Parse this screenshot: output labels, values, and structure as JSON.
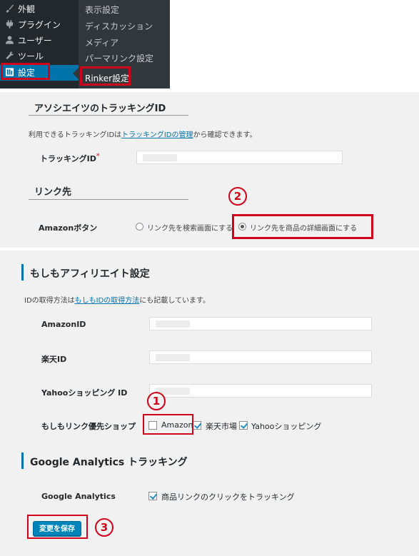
{
  "admin_menu": {
    "items": [
      {
        "label": "外観",
        "icon": "paintbrush-icon"
      },
      {
        "label": "プラグイン",
        "icon": "plugin-icon"
      },
      {
        "label": "ユーザー",
        "icon": "user-icon"
      },
      {
        "label": "ツール",
        "icon": "wrench-icon"
      },
      {
        "label": "設定",
        "icon": "settings-icon",
        "active": true
      }
    ],
    "submenu": [
      {
        "label": "表示設定"
      },
      {
        "label": "ディスカッション"
      },
      {
        "label": "メディア"
      },
      {
        "label": "パーマリンク設定"
      },
      {
        "label": "Rinker設定",
        "current": true
      }
    ]
  },
  "associate": {
    "title": "アソシエイツのトラッキングID",
    "desc_before": "利用できるトラッキングIDは",
    "desc_link": "トラッキングIDの管理",
    "desc_after": "から確認できます。",
    "tracking_label": "トラッキングID",
    "required_mark": "*",
    "tracking_value": ""
  },
  "link_dest": {
    "title": "リンク先",
    "amazon_button_label": "Amazonボタン",
    "option_search": "リンク先を検索画面にする",
    "option_detail": "リンク先を商品の詳細画面にする",
    "selected": "detail"
  },
  "moshimo": {
    "title": "もしもアフィリエイト設定",
    "desc_before": "IDの取得方法は",
    "desc_link": "もしもIDの取得方法",
    "desc_after": "にも記載しています。",
    "amazon_id_label": "AmazonID",
    "rakuten_id_label": "楽天ID",
    "yahoo_id_label": "Yahooショッピング ID",
    "priority_label": "もしもリンク優先ショップ",
    "shops": [
      {
        "label": "Amazon",
        "checked": false
      },
      {
        "label": "楽天市場",
        "checked": true
      },
      {
        "label": "Yahooショッピング",
        "checked": true
      }
    ]
  },
  "analytics": {
    "title": "Google Analytics トラッキング",
    "label": "Google Analytics",
    "option": "商品リンクのクリックをトラッキング",
    "checked": true
  },
  "save_button": "変更を保存",
  "annotations": {
    "n1": "1",
    "n2": "2",
    "n3": "3"
  },
  "colors": {
    "accent": "#0073aa",
    "annotation": "#d0021b",
    "button": "#0085ba"
  }
}
